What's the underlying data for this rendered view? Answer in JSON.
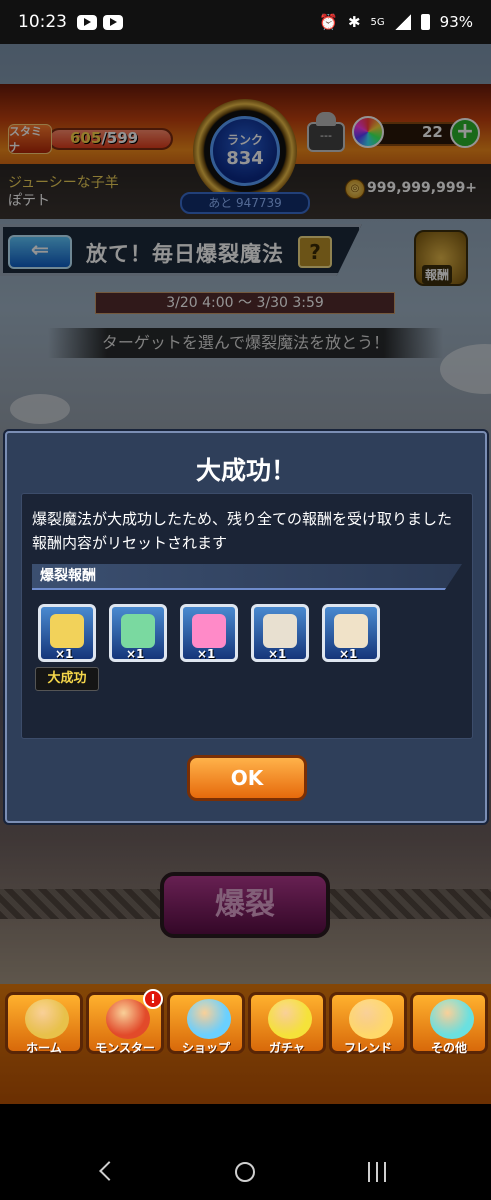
{
  "status_bar": {
    "time": "10:23",
    "network": "5G",
    "battery": "93%"
  },
  "hud": {
    "stamina_label": "スタミナ",
    "stamina_current": "605",
    "stamina_max": "/599",
    "rank_label": "ランク",
    "rank_value": "834",
    "rank_next": "あと 947739",
    "helper_label": "---",
    "orb_count": "22",
    "plus_symbol": "+",
    "player_name": "ジューシーな子羊",
    "player_sub": "ぽテト",
    "coins": "999,999,999+"
  },
  "event": {
    "title": "放て！毎日爆裂魔法",
    "help": "?",
    "reward_badge": "報酬",
    "period": "3/20 4:00 〜 3/30 3:59",
    "guide": "ターゲットを選んで爆裂魔法を放とう！",
    "action_button": "爆裂"
  },
  "modal": {
    "title": "大成功！",
    "message_line1": "爆裂魔法が大成功したため、残り全ての報酬を受け取りました",
    "message_line2": "報酬内容がリセットされます",
    "section_header": "爆裂報酬",
    "items": [
      {
        "icon": "ticket-icon",
        "qty": "×1",
        "color": "#f2d25a"
      },
      {
        "icon": "magnifier-icon",
        "qty": "×1",
        "color": "#7ad9a0"
      },
      {
        "icon": "heart-potion-icon",
        "qty": "×1",
        "color": "#ff8ac8"
      },
      {
        "icon": "scroll-icon",
        "qty": "×1",
        "color": "#e8e0d0"
      },
      {
        "icon": "fossil-icon",
        "qty": "×1",
        "color": "#f0e2c8"
      }
    ],
    "badge": "大成功",
    "ok_button": "OK"
  },
  "menu": [
    {
      "label": "ホーム",
      "icon": "home-icon",
      "color": "#e8c14a"
    },
    {
      "label": "モンスター",
      "icon": "monster-icon",
      "color": "#e24a2a",
      "alert": "!"
    },
    {
      "label": "ショップ",
      "icon": "shop-orb-icon",
      "color": "#6ad0ff"
    },
    {
      "label": "ガチャ",
      "icon": "gacha-icon",
      "color": "#f5e23a"
    },
    {
      "label": "フレンド",
      "icon": "friend-icon",
      "color": "#ffd86a"
    },
    {
      "label": "その他",
      "icon": "other-icon",
      "color": "#6ae0e0"
    }
  ]
}
